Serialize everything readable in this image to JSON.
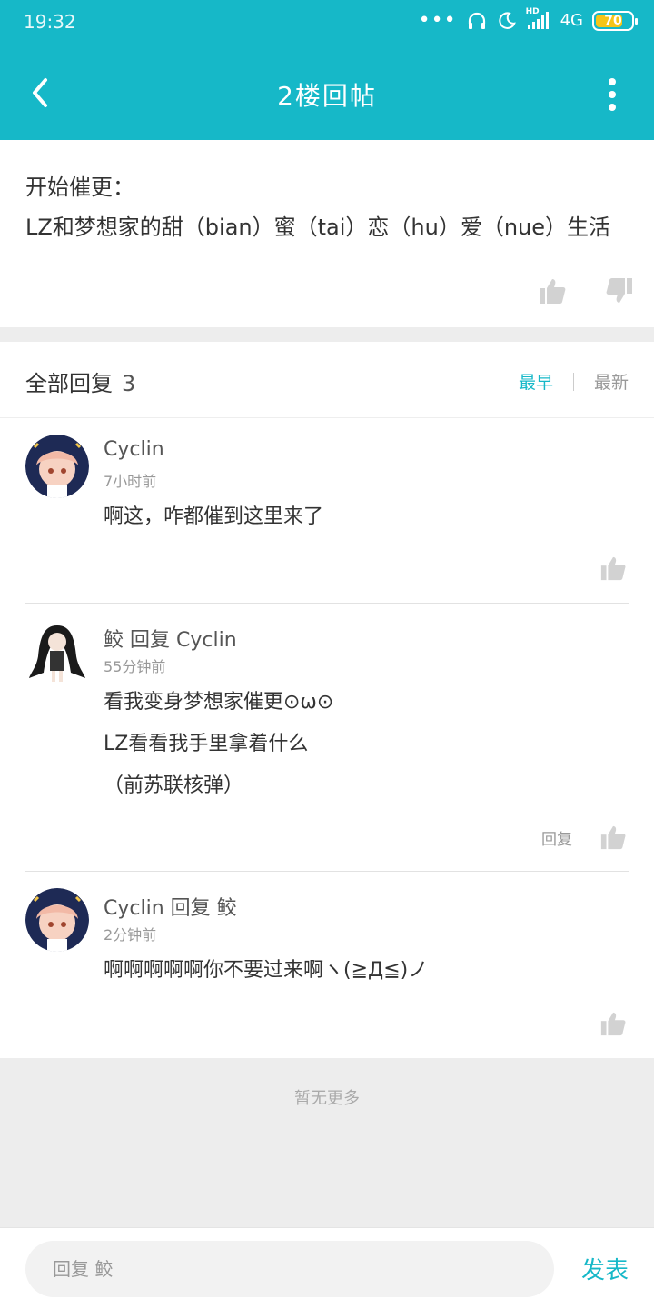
{
  "status_bar": {
    "time": "19:32",
    "signal_label": "4G",
    "hd_label": "HD",
    "battery": "70"
  },
  "app_bar": {
    "title": "2楼回帖"
  },
  "post": {
    "line1": "开始催更：",
    "line2": "LZ和梦想家的甜（bian）蜜（tai）恋（hu）爱（nue）生活"
  },
  "replies_header": {
    "label": "全部回复",
    "count": "3",
    "sort_earliest": "最早",
    "sort_newest": "最新"
  },
  "replies": [
    {
      "name": "Cyclin",
      "time": "7小时前",
      "lines": [
        "啊这，咋都催到这里来了"
      ]
    },
    {
      "name": "鲛 回复 Cyclin",
      "time": "55分钟前",
      "lines": [
        "看我变身梦想家催更⊙ω⊙",
        "LZ看看我手里拿着什么",
        "（前苏联核弹）"
      ],
      "reply_label": "回复"
    },
    {
      "name": "Cyclin 回复 鲛",
      "time": "2分钟前",
      "lines": [
        "啊啊啊啊啊你不要过来啊ヽ(≧Д≦)ノ"
      ]
    }
  ],
  "no_more": "暂无更多",
  "input_bar": {
    "placeholder": "回复 鲛",
    "send_label": "发表"
  },
  "colors": {
    "accent": "#16b8c8",
    "background_gray": "#ededed"
  }
}
